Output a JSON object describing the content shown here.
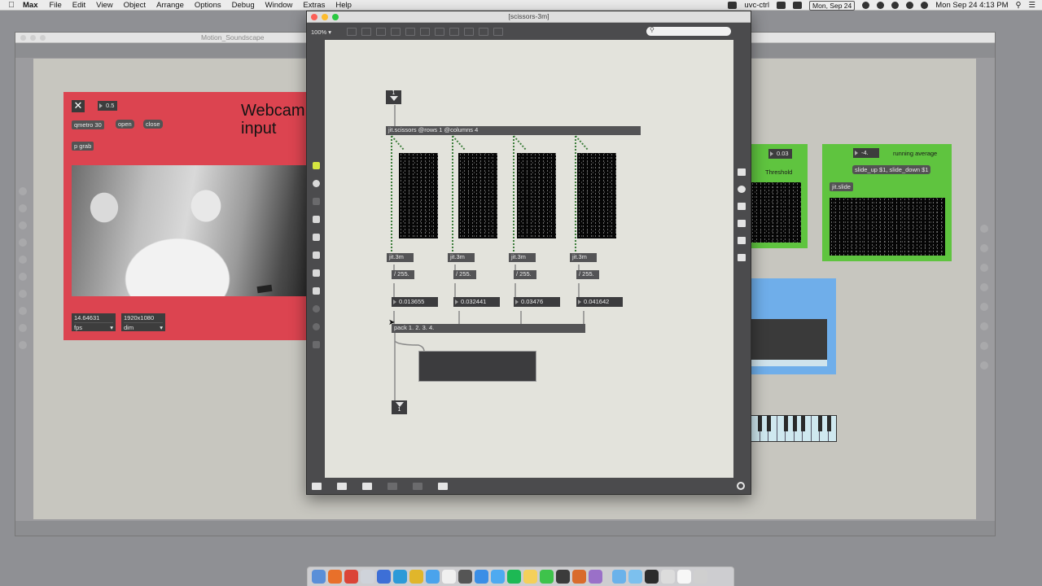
{
  "menubar": {
    "app_name": "Max",
    "items": [
      "File",
      "Edit",
      "View",
      "Object",
      "Arrange",
      "Options",
      "Debug",
      "Window",
      "Extras",
      "Help"
    ],
    "status_app": "uvc-ctrl",
    "date_badge": "Mon, Sep 24",
    "clock": "Mon Sep 24  4:13 PM"
  },
  "background_window": {
    "title": "Motion_Soundscape",
    "red_panel": {
      "title": "Webcam\ninput",
      "toggle_value": "0.5",
      "metro": "qmetro 30",
      "open": "open",
      "close": "close",
      "grab": "p grab",
      "fps_value": "14.64631",
      "fps_label": "fps",
      "dim_value": "1920x1080",
      "dim_label": "dim"
    },
    "green_panel_1": {
      "value": "0.03",
      "label": "Threshold"
    },
    "green_panel_2": {
      "value": "-4.",
      "label": "running average",
      "message": "slide_up $1, slide_down $1",
      "object": "jit.slide"
    }
  },
  "front_window": {
    "title": "[scissors-3m]",
    "zoom": "100%",
    "search_placeholder": "",
    "inlet_label": "1",
    "outlet_label": "1",
    "scissors": "jit.scissors @rows 1 @columns 4",
    "columns": [
      {
        "obj": "jit.3m",
        "div": "/ 255.",
        "value": "0.013655"
      },
      {
        "obj": "jit.3m",
        "div": "/ 255.",
        "value": "0.032441"
      },
      {
        "obj": "jit.3m",
        "div": "/ 255.",
        "value": "0.03476"
      },
      {
        "obj": "jit.3m",
        "div": "/ 255.",
        "value": "0.041642"
      }
    ],
    "pack": "pack 1. 2. 3. 4."
  },
  "colors": {
    "red_panel": "#dc4450",
    "green_panel": "#5fc43f",
    "blue_panel": "#6faeea",
    "patcher_bg": "#e3e3dc",
    "window_chrome": "#4b4b4d"
  },
  "icons": {
    "menubar": [
      "apple-icon",
      "dropbox-icon",
      "time-machine-icon",
      "wifi-icon",
      "search-icon",
      "notification-icon"
    ],
    "left_sidebar": [
      "cube-icon",
      "target-icon",
      "bar-icon",
      "music-note-icon",
      "video-icon",
      "image-icon",
      "paperclip-icon",
      "plug-icon",
      "circle-icon",
      "circle-icon",
      "star-icon"
    ],
    "right_sidebar": [
      "list-icon",
      "info-icon",
      "book-icon",
      "list-icon",
      "book-open-icon",
      "camera-icon"
    ],
    "bottom": [
      "lock-icon",
      "presentation-icon",
      "monitor-icon",
      "grid-icon",
      "ruler-icon",
      "wrench-icon",
      "power-icon"
    ]
  }
}
